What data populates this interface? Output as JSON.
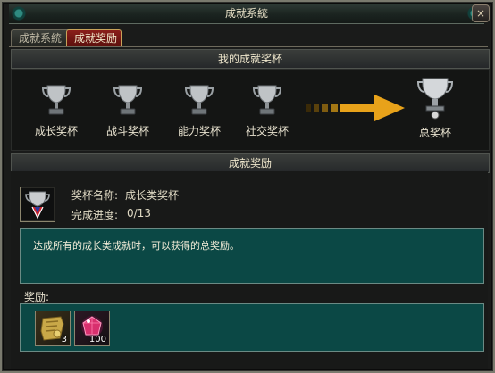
{
  "window": {
    "title": "成就系統",
    "close_label": "×"
  },
  "tabs": [
    {
      "label": "成就系統",
      "active": false
    },
    {
      "label": "成就奖励",
      "active": true
    }
  ],
  "trophies": {
    "header": "我的成就奖杯",
    "items": [
      {
        "label": "成长奖杯",
        "icon": "silver-trophy-icon"
      },
      {
        "label": "战斗奖杯",
        "icon": "silver-trophy-icon"
      },
      {
        "label": "能力奖杯",
        "icon": "silver-trophy-icon"
      },
      {
        "label": "社交奖杯",
        "icon": "silver-trophy-icon"
      }
    ],
    "final": {
      "label": "总奖杯",
      "icon": "grand-trophy-icon"
    },
    "arrow_color": "#e8a21a"
  },
  "reward": {
    "header": "成就奖励",
    "cup_name_label": "奖杯名称:",
    "cup_name_value": "成长类奖杯",
    "progress_label": "完成进度:",
    "progress_value": "0/13",
    "description": "达成所有的成长类成就时，可以获得的总奖励。",
    "items_label": "奖励:",
    "items": [
      {
        "icon": "gold-scroll-icon",
        "count": "3"
      },
      {
        "icon": "red-gem-icon",
        "count": "100"
      }
    ]
  },
  "colors": {
    "panel_teal": "#0b4845",
    "accent_gold": "#e8a21a",
    "tab_active": "#7a1a16"
  }
}
